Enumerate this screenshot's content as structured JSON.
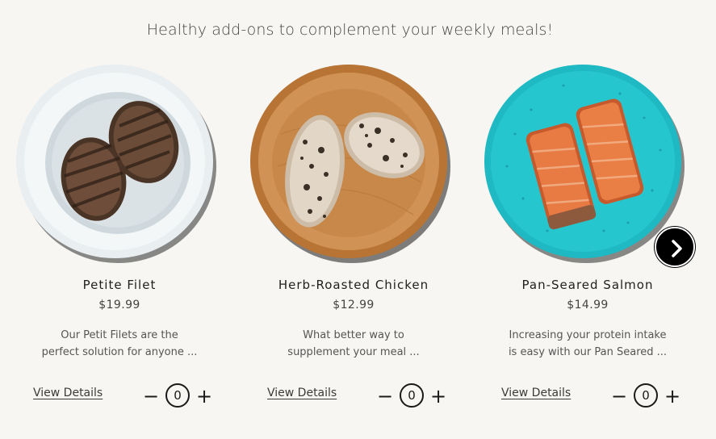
{
  "headline": "Healthy add-ons to complement your weekly meals!",
  "products": [
    {
      "name": "Petite Filet",
      "price": "$19.99",
      "desc_line1": "Our Petit Filets are the",
      "desc_line2": "perfect solution for anyone  ...",
      "details_label": "View Details",
      "quantity": "0",
      "plate_color": "#dfe6ea"
    },
    {
      "name": "Herb-Roasted Chicken",
      "price": "$12.99",
      "desc_line1": "What better way to",
      "desc_line2": "supplement your meal     ...",
      "details_label": "View Details",
      "quantity": "0",
      "plate_color": "#c98a4a"
    },
    {
      "name": "Pan-Seared Salmon",
      "price": "$14.99",
      "desc_line1": "Increasing your protein intake",
      "desc_line2": "is easy with our Pan Seared  ...",
      "details_label": "View Details",
      "quantity": "0",
      "plate_color": "#22c3cc"
    }
  ],
  "stepper": {
    "minus_symbol": "−",
    "plus_symbol": "+"
  },
  "icons": {
    "next": "chevron-right-icon"
  }
}
